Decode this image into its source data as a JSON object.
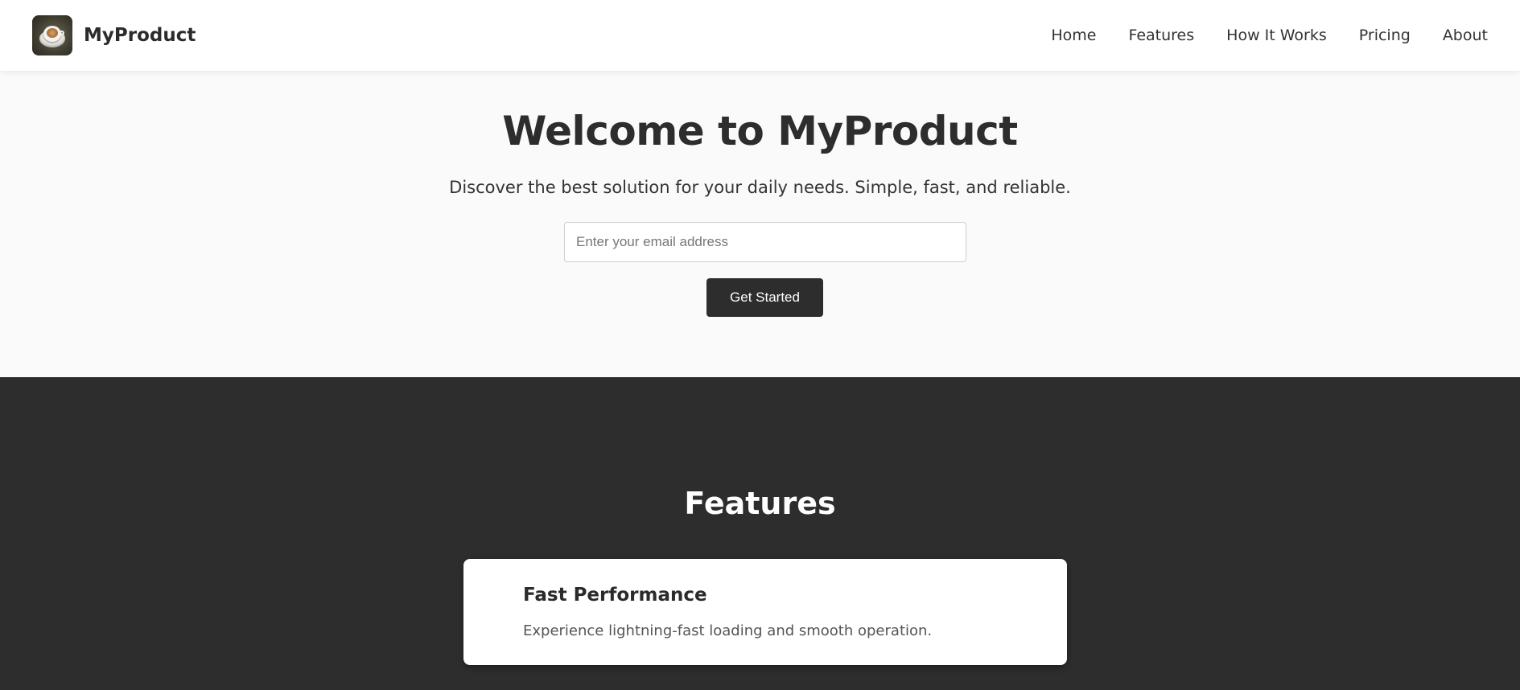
{
  "navbar": {
    "brand": "MyProduct",
    "logo_icon": "coffee-cup-icon",
    "links": [
      {
        "label": "Home"
      },
      {
        "label": "Features"
      },
      {
        "label": "How It Works"
      },
      {
        "label": "Pricing"
      },
      {
        "label": "About"
      }
    ]
  },
  "hero": {
    "title": "Welcome to MyProduct",
    "subtitle": "Discover the best solution for your daily needs. Simple, fast, and reliable.",
    "email_placeholder": "Enter your email address",
    "email_value": "",
    "cta_label": "Get Started"
  },
  "features": {
    "title": "Features",
    "items": [
      {
        "title": "Fast Performance",
        "description": "Experience lightning-fast loading and smooth operation."
      }
    ]
  },
  "colors": {
    "dark": "#2d2d2d",
    "light_bg": "#fafafa",
    "white": "#ffffff"
  }
}
